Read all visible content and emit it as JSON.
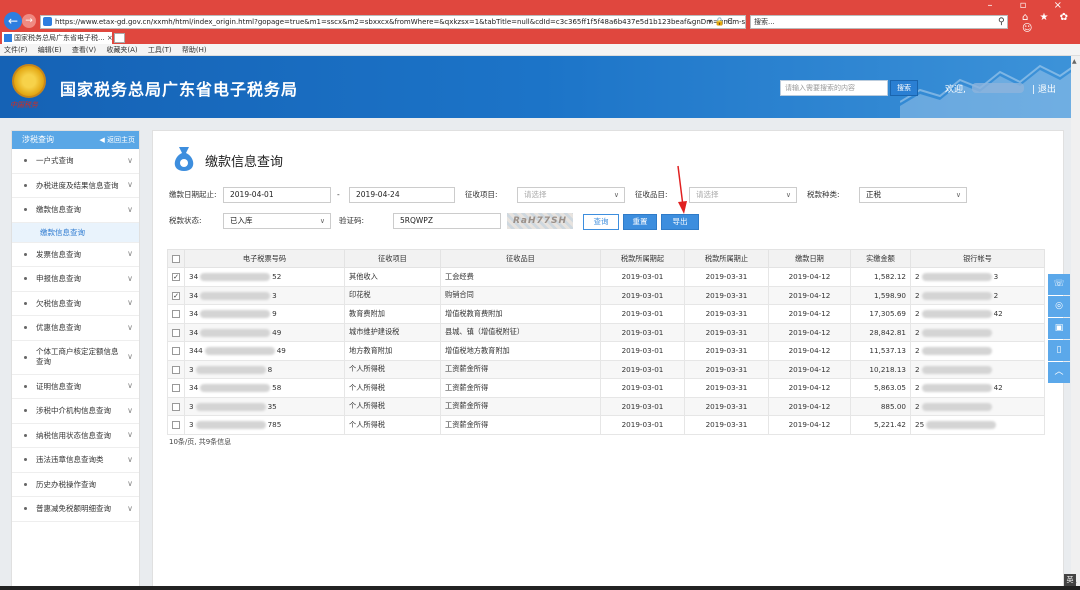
{
  "browser": {
    "url": "https://www.etax-gd.gov.cn/xxmh/html/index_origin.html?gopage=true&m1=sscx&m2=sbxxcx&fromWhere=&qxkzsx=1&tabTitle=null&cdId=c3c365ff1f5f48a6b437e5d1b123beaf&gnDm=gndm-sbxxcx#",
    "addr_tools": "▾ 🔒 C",
    "search_placeholder": "搜索...",
    "tab_title": "国家税务总局广东省电子税...",
    "tab_close": "×",
    "win_controls": "–  ▫  ×",
    "right_icons": "⌂ ★ ✿ ☺"
  },
  "menu": [
    "文件(F)",
    "编辑(E)",
    "查看(V)",
    "收藏夹(A)",
    "工具(T)",
    "帮助(H)"
  ],
  "header": {
    "emblem_text": "中国税务",
    "title": "国家税务总局广东省电子税务局",
    "search_placeholder": "请输入需要搜索的内容",
    "search_btn": "搜索",
    "welcome": "欢迎,",
    "logout": "| 退出"
  },
  "sidebar": {
    "title": "涉税查询",
    "back": "◀ 返回主页",
    "items": [
      {
        "label": "一户式查询"
      },
      {
        "label": "办税进度及结果信息查询"
      },
      {
        "label": "缴款信息查询"
      },
      {
        "label": "发票信息查询"
      },
      {
        "label": "申报信息查询"
      },
      {
        "label": "欠税信息查询"
      },
      {
        "label": "优惠信息查询"
      },
      {
        "label": "个体工商户核定定额信息查询"
      },
      {
        "label": "证明信息查询"
      },
      {
        "label": "涉税中介机构信息查询"
      },
      {
        "label": "纳税信用状态信息查询"
      },
      {
        "label": "违法违章信息查询类"
      },
      {
        "label": "历史办税操作查询"
      },
      {
        "label": "普惠减免税额明细查询"
      }
    ],
    "active_sub": "缴款信息查询"
  },
  "page": {
    "title": "缴款信息查询",
    "form": {
      "date_label": "缴款日期起止:",
      "date_from": "2019-04-01",
      "date_sep": "-",
      "date_to": "2019-04-24",
      "levy_item_label": "征收项目:",
      "levy_item_placeholder": "请选择",
      "levy_product_label": "征收品目:",
      "levy_product_placeholder": "请选择",
      "tax_type_label": "税款种类:",
      "tax_type_value": "正税",
      "status_label": "税款状态:",
      "status_value": "已入库",
      "captcha_label": "验证码:",
      "captcha_value": "5RQWPZ",
      "captcha_image_text": "RaH77SH",
      "btn_query": "查询",
      "btn_reset": "重置",
      "btn_export": "导出"
    },
    "table": {
      "headers": [
        "电子税票号码",
        "征收项目",
        "征收品目",
        "税款所属期起",
        "税款所属期止",
        "缴款日期",
        "实缴金额",
        "银行帐号"
      ],
      "rows": [
        {
          "checked": "✓",
          "ticket_start": "34",
          "ticket_end": "52",
          "item": "其他收入",
          "product": "工会经费",
          "period_from": "2019-03-01",
          "period_to": "2019-03-31",
          "pay_date": "2019-04-12",
          "amount": "1,582.12",
          "acct_start": "2",
          "acct_end": "3"
        },
        {
          "checked": "✓",
          "ticket_start": "34",
          "ticket_end": "3",
          "item": "印花税",
          "product": "购销合同",
          "period_from": "2019-03-01",
          "period_to": "2019-03-31",
          "pay_date": "2019-04-12",
          "amount": "1,598.90",
          "acct_start": "2",
          "acct_end": "2"
        },
        {
          "checked": "",
          "ticket_start": "34",
          "ticket_end": "9",
          "item": "教育费附加",
          "product": "增值税教育费附加",
          "period_from": "2019-03-01",
          "period_to": "2019-03-31",
          "pay_date": "2019-04-12",
          "amount": "17,305.69",
          "acct_start": "2",
          "acct_end": "42"
        },
        {
          "checked": "",
          "ticket_start": "34",
          "ticket_end": "49",
          "item": "城市维护建设税",
          "product": "县城、镇（增值税附征）",
          "period_from": "2019-03-01",
          "period_to": "2019-03-31",
          "pay_date": "2019-04-12",
          "amount": "28,842.81",
          "acct_start": "2",
          "acct_end": ""
        },
        {
          "checked": "",
          "ticket_start": "344",
          "ticket_end": "49",
          "item": "地方教育附加",
          "product": "增值税地方教育附加",
          "period_from": "2019-03-01",
          "period_to": "2019-03-31",
          "pay_date": "2019-04-12",
          "amount": "11,537.13",
          "acct_start": "2",
          "acct_end": ""
        },
        {
          "checked": "",
          "ticket_start": "3",
          "ticket_end": "8",
          "item": "个人所得税",
          "product": "工资薪金所得",
          "period_from": "2019-03-01",
          "period_to": "2019-03-31",
          "pay_date": "2019-04-12",
          "amount": "10,218.13",
          "acct_start": "2",
          "acct_end": ""
        },
        {
          "checked": "",
          "ticket_start": "34",
          "ticket_end": "58",
          "item": "个人所得税",
          "product": "工资薪金所得",
          "period_from": "2019-03-01",
          "period_to": "2019-03-31",
          "pay_date": "2019-04-12",
          "amount": "5,863.05",
          "acct_start": "2",
          "acct_end": "42"
        },
        {
          "checked": "",
          "ticket_start": "3",
          "ticket_end": "35",
          "item": "个人所得税",
          "product": "工资薪金所得",
          "period_from": "2019-03-01",
          "period_to": "2019-03-31",
          "pay_date": "2019-04-12",
          "amount": "885.00",
          "acct_start": "2",
          "acct_end": ""
        },
        {
          "checked": "",
          "ticket_start": "3",
          "ticket_end": "785",
          "item": "个人所得税",
          "product": "工资薪金所得",
          "period_from": "2019-03-01",
          "period_to": "2019-03-31",
          "pay_date": "2019-04-12",
          "amount": "5,221.42",
          "acct_start": "25",
          "acct_end": ""
        }
      ]
    },
    "pager": "10条/页, 共9条信息"
  },
  "float_tools": [
    "☏",
    "◎",
    "▣",
    "▯",
    "︿"
  ],
  "ime": "英"
}
